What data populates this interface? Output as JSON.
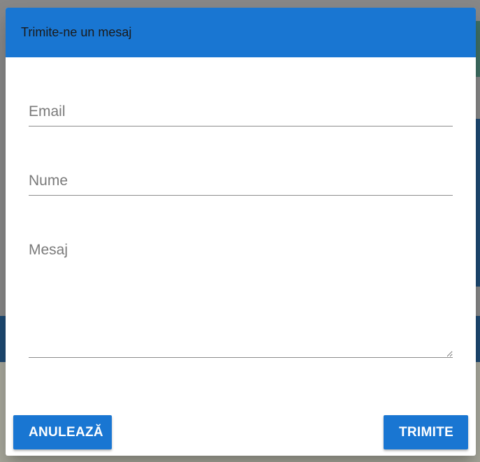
{
  "dialog": {
    "title": "Trimite-ne un mesaj",
    "fields": {
      "email_placeholder": "Email",
      "name_placeholder": "Nume",
      "message_placeholder": "Mesaj"
    },
    "actions": {
      "cancel_label": "ANULEAZĂ",
      "send_label": "TRIMITE"
    }
  },
  "colors": {
    "primary": "#1976d2",
    "backdrop": "#878787"
  }
}
